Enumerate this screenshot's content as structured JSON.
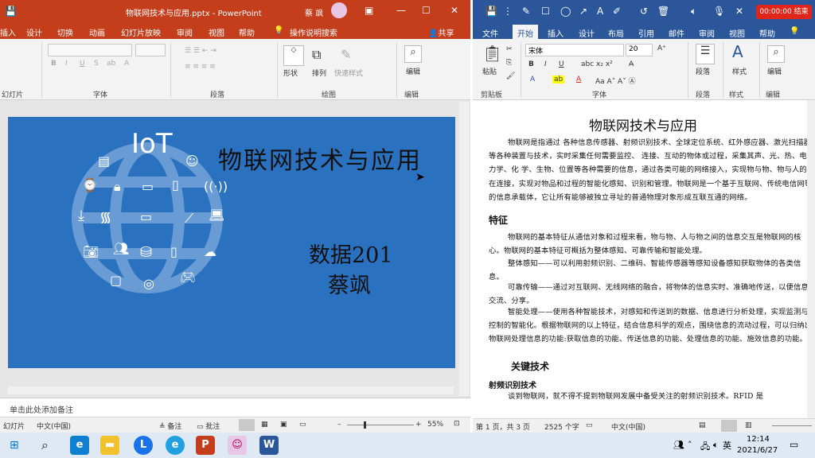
{
  "ppt": {
    "title": "物联网技术与应用.pptx  -  PowerPoint",
    "user": "蔡 飒",
    "tabs": [
      "插入",
      "设计",
      "切换",
      "动画",
      "幻灯片放映",
      "审阅",
      "视图",
      "帮助"
    ],
    "tell_me": "操作说明搜索",
    "share": "共享",
    "groups": [
      "幻灯片",
      "字体",
      "段落",
      "绘图",
      "编辑"
    ],
    "font_buttons": [
      "B",
      "I",
      "U",
      "S",
      "ab",
      "A"
    ],
    "buttons": {
      "shape": "形状",
      "arrange": "排列",
      "quick_styles": "快速样式",
      "edit": "编辑"
    },
    "slide": {
      "iot_label": "IoT",
      "title": "物联网技术与应用",
      "class": "数据201",
      "name": "蔡飒"
    },
    "notes": "单击此处添加备注",
    "status": {
      "slide": "幻灯片",
      "lang": "中文(中国)",
      "notes": "备注",
      "comments": "批注",
      "zoom": "55%"
    }
  },
  "word": {
    "toolbar_time": "00:00:00 结束",
    "tabs": [
      "文件",
      "开始",
      "插入",
      "设计",
      "布局",
      "引用",
      "邮件",
      "审阅",
      "视图",
      "帮助"
    ],
    "font_name": "宋体",
    "font_size": "20",
    "groups": [
      "剪贴板",
      "字体",
      "段落",
      "样式",
      "编辑"
    ],
    "paste": "粘贴",
    "paragraph_btn": "段落",
    "style_btn": "样式",
    "edit_btn": "编辑",
    "doc": {
      "title": "物联网技术与应用",
      "p1": "物联网是指通过  各种信息传感器、射频识别技术、全球定位系统、红外感应器、激光扫描器等各种装置与技术，实时采集任何需要监控、 连接、互动的物体或过程，采集其声、光、热、电、力学、化  学、生物、位置等各种需要的信息，通过各类可能的网络接入，实现物与物、物与人的泛在连接，实现对物品和过程的智能化感知、识别和管理。物联网是一个基于互联网、传统电信网等的信息承载体，它让所有能够被独立寻址的普通物理对象形成互联互通的网络。",
      "h_features": "特征",
      "p2": "物联网的基本特征从通信对象和过程来看，物与物、人与物之间的信息交互是物联网的核心。物联网的基本特征可概括为整体感知、可靠传输和智能处理。",
      "p3": "整体感知——可以利用射频识别、二维码、智能传感器等感知设备感知获取物体的各类信息。",
      "p4": "可靠传输——通过对互联网、无线网络的融合，将物体的信息实时、准确地传送，以便信息交流、分享。",
      "p5": "智能处理——使用各种智能技术，对感知和传送到的数据、信息进行分析处理，实现监测与控制的智能化。根据物联网的以上特征，结合信息科学的观点，围绕信息的流动过程，可以归纳出物联网处理信息的功能:获取信息的功能、传送信息的功能、处理信息的功能、施效信息的功能。",
      "h_key": "关键技术",
      "h_rfid": "射频识别技术",
      "p6": "谈到物联网，就不得不提到物联网发展中备受关注的射频识别技术。RFID 是"
    },
    "status": {
      "page": "第 1 页，共 3 页",
      "words": "2525 个字",
      "lang": "中文(中国)"
    }
  },
  "taskbar": {
    "time": "12:14",
    "date": "2021/6/27",
    "ime": "英"
  },
  "colors": {
    "ppt": "#c43e1c",
    "word": "#2b579a",
    "slide": "#2a72bf"
  }
}
